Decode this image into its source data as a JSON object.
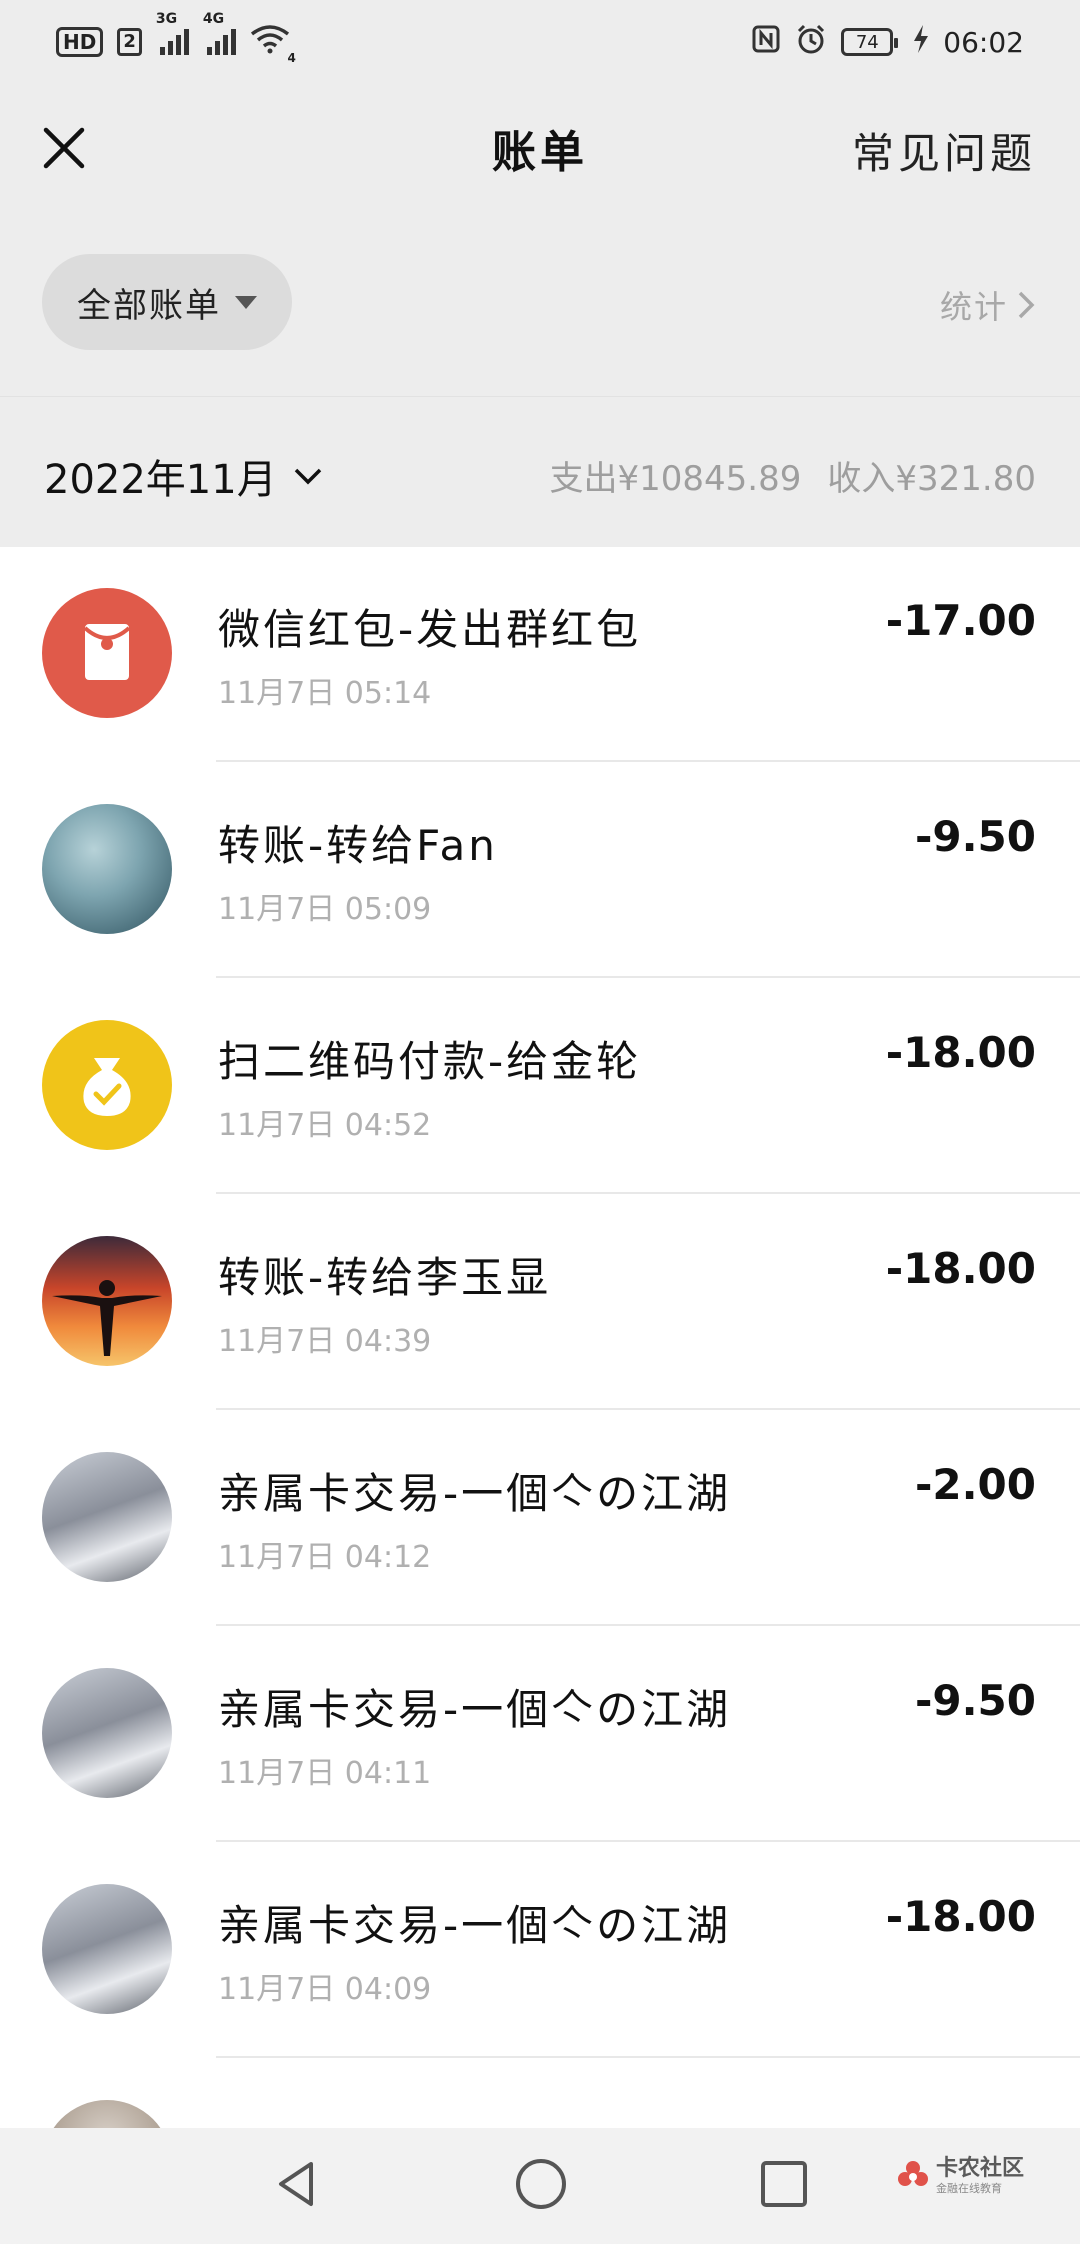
{
  "status_bar": {
    "hd": "HD",
    "sim": "2",
    "net1": "3G",
    "net2": "4G",
    "wifi_tag": "4",
    "battery": "74",
    "time": "06:02"
  },
  "header": {
    "title": "账单",
    "faq": "常见问题"
  },
  "filter": {
    "all_bills": "全部账单",
    "stats": "统计"
  },
  "month_bar": {
    "month": "2022年11月",
    "expense": "支出¥10845.89",
    "income": "收入¥321.80"
  },
  "transactions": [
    {
      "title": "微信红包-发出群红包",
      "time": "11月7日  05:14",
      "amount": "-17.00",
      "avatar": "red-envelope-icon",
      "color": "#e05a4a"
    },
    {
      "title": "转账-转给Fan",
      "time": "11月7日  05:09",
      "amount": "-9.50",
      "avatar": "photo-avatar",
      "color": "#6f9aa8"
    },
    {
      "title": "扫二维码付款-给金轮",
      "time": "11月7日  04:52",
      "amount": "-18.00",
      "avatar": "money-bag-icon",
      "color": "#f0c419"
    },
    {
      "title": "转账-转给李玉显",
      "time": "11月7日  04:39",
      "amount": "-18.00",
      "avatar": "sunset-avatar",
      "color": "#d3542b"
    },
    {
      "title": "亲属卡交易-一個亽の江湖",
      "time": "11月7日  04:12",
      "amount": "-2.00",
      "avatar": "car-avatar",
      "color": "#8a8f9a"
    },
    {
      "title": "亲属卡交易-一個亽の江湖",
      "time": "11月7日  04:11",
      "amount": "-9.50",
      "avatar": "car-avatar",
      "color": "#8a8f9a"
    },
    {
      "title": "亲属卡交易-一個亽の江湖",
      "time": "11月7日  04:09",
      "amount": "-18.00",
      "avatar": "car-avatar",
      "color": "#8a8f9a"
    }
  ],
  "watermark": {
    "main": "卡农社区",
    "sub": "金融在线教育"
  }
}
